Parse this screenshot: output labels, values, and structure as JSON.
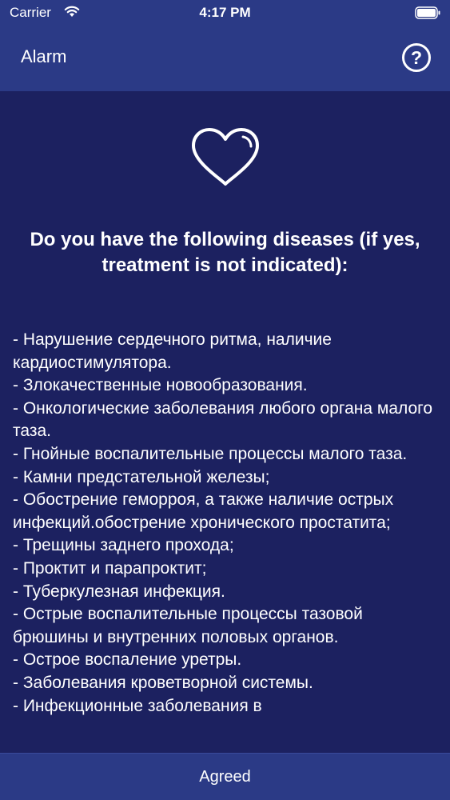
{
  "status_bar": {
    "carrier": "Carrier",
    "time": "4:17 PM",
    "wifi_icon": "wifi-icon",
    "battery_icon": "battery-icon"
  },
  "nav": {
    "title": "Alarm",
    "help_label": "?",
    "help_icon": "question-circle-icon"
  },
  "content": {
    "heart_icon": "heart-outline-icon",
    "question": "Do you have the following diseases (if yes, treatment is not indicated):",
    "items": [
      "- Нарушение сердечного ритма, наличие кардиостимулятора.",
      "- Злокачественные новообразования.",
      "- Онкологические заболевания любого органа малого таза.",
      "- Гнойные воспалительные процессы малого таза.",
      "- Камни предстательной железы;",
      "- Обострение геморроя, а также наличие острых инфекций.обострение хронического простатита;",
      "- Трещины заднего прохода;",
      "- Проктит и парапроктит;",
      "- Туберкулезная инфекция.",
      "- Острые воспалительные процессы тазовой брюшины и внутренних половых органов.",
      "- Острое воспаление уретры.",
      "- Заболевания кроветворной системы.",
      "- Инфекционные заболевания в"
    ]
  },
  "footer": {
    "agree_label": "Agreed"
  },
  "colors": {
    "background": "#1c2160",
    "bar": "#2b3a86",
    "text": "#ffffff"
  }
}
